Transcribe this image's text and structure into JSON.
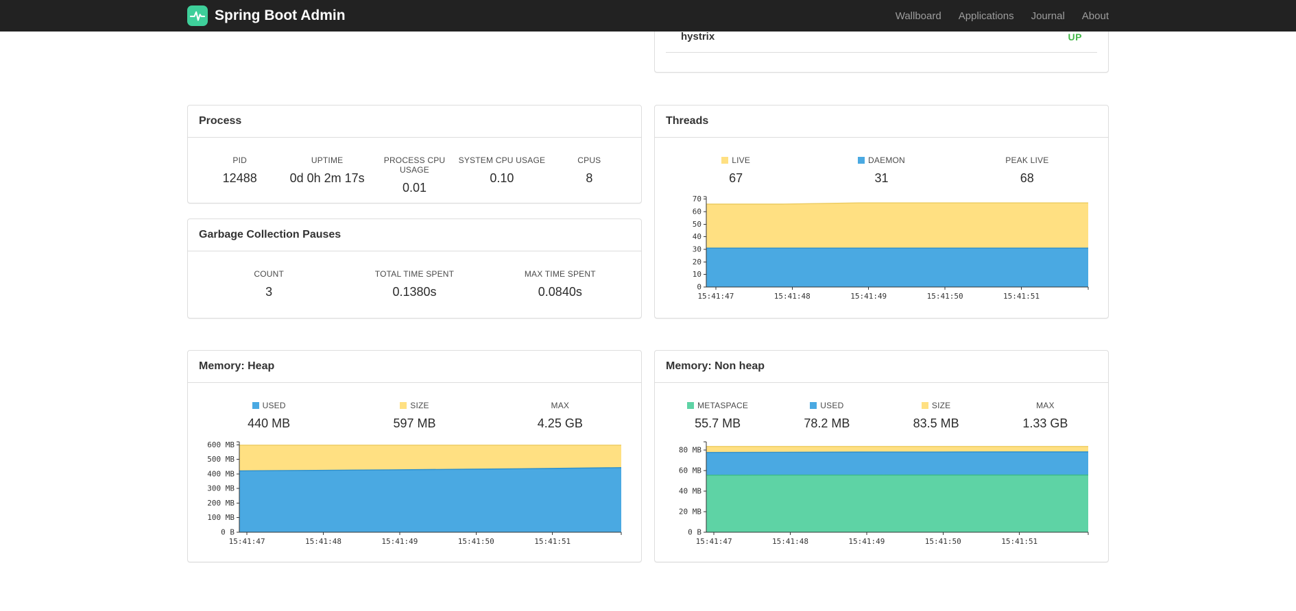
{
  "navbar": {
    "brand": "Spring Boot Admin",
    "links": [
      {
        "label": "Wallboard"
      },
      {
        "label": "Applications"
      },
      {
        "label": "Journal"
      },
      {
        "label": "About"
      }
    ]
  },
  "status_panel": {
    "app_name": "hystrix",
    "status": "UP",
    "status_color": "#44b749"
  },
  "process": {
    "title": "Process",
    "stats": [
      {
        "label": "PID",
        "value": "12488"
      },
      {
        "label": "UPTIME",
        "value": "0d 0h 2m 17s"
      },
      {
        "label": "PROCESS CPU USAGE",
        "value": "0.01"
      },
      {
        "label": "SYSTEM CPU USAGE",
        "value": "0.10"
      },
      {
        "label": "CPUS",
        "value": "8"
      }
    ]
  },
  "gc": {
    "title": "Garbage Collection Pauses",
    "stats": [
      {
        "label": "COUNT",
        "value": "3"
      },
      {
        "label": "TOTAL TIME SPENT",
        "value": "0.1380s"
      },
      {
        "label": "MAX TIME SPENT",
        "value": "0.0840s"
      }
    ]
  },
  "threads": {
    "title": "Threads",
    "stats": [
      {
        "label": "LIVE",
        "value": "67",
        "color": "#ffe082"
      },
      {
        "label": "DAEMON",
        "value": "31",
        "color": "#4aa9e2"
      },
      {
        "label": "PEAK LIVE",
        "value": "68"
      }
    ]
  },
  "heap": {
    "title": "Memory: Heap",
    "stats": [
      {
        "label": "USED",
        "value": "440 MB",
        "color": "#4aa9e2"
      },
      {
        "label": "SIZE",
        "value": "597 MB",
        "color": "#ffe082"
      },
      {
        "label": "MAX",
        "value": "4.25 GB"
      }
    ]
  },
  "nonheap": {
    "title": "Memory: Non heap",
    "stats": [
      {
        "label": "METASPACE",
        "value": "55.7 MB",
        "color": "#5ed3a5"
      },
      {
        "label": "USED",
        "value": "78.2 MB",
        "color": "#4aa9e2"
      },
      {
        "label": "SIZE",
        "value": "83.5 MB",
        "color": "#ffe082"
      },
      {
        "label": "MAX",
        "value": "1.33 GB"
      }
    ]
  },
  "chart_data": [
    {
      "id": "threads",
      "type": "area",
      "title": "Threads",
      "ylim": [
        0,
        72
      ],
      "grid": false,
      "legend_position": "top",
      "yticks": [
        {
          "v": 0,
          "label": "0"
        },
        {
          "v": 10,
          "label": "10"
        },
        {
          "v": 20,
          "label": "20"
        },
        {
          "v": 30,
          "label": "30"
        },
        {
          "v": 40,
          "label": "40"
        },
        {
          "v": 50,
          "label": "50"
        },
        {
          "v": 60,
          "label": "60"
        },
        {
          "v": 70,
          "label": "70"
        }
      ],
      "xticks": [
        {
          "pos": 0.025,
          "label": "15:41:47"
        },
        {
          "pos": 0.225,
          "label": "15:41:48"
        },
        {
          "pos": 0.425,
          "label": "15:41:49"
        },
        {
          "pos": 0.625,
          "label": "15:41:50"
        },
        {
          "pos": 0.825,
          "label": "15:41:51"
        }
      ],
      "series": [
        {
          "name": "LIVE",
          "color": "#ffe082",
          "line": "#eccb5f",
          "values": [
            66,
            66,
            67,
            67,
            67,
            67
          ]
        },
        {
          "name": "DAEMON",
          "color": "#4aa9e2",
          "line": "#2d8fcc",
          "values": [
            31,
            31,
            31,
            31,
            31,
            31
          ]
        }
      ]
    },
    {
      "id": "heap",
      "type": "area",
      "title": "Memory: Heap",
      "ylim": [
        0,
        620
      ],
      "grid": false,
      "legend_position": "top",
      "yticks": [
        {
          "v": 0,
          "label": "0 B"
        },
        {
          "v": 100,
          "label": "100 MB"
        },
        {
          "v": 200,
          "label": "200 MB"
        },
        {
          "v": 300,
          "label": "300 MB"
        },
        {
          "v": 400,
          "label": "400 MB"
        },
        {
          "v": 500,
          "label": "500 MB"
        },
        {
          "v": 600,
          "label": "600 MB"
        }
      ],
      "xticks": [
        {
          "pos": 0.02,
          "label": "15:41:47"
        },
        {
          "pos": 0.22,
          "label": "15:41:48"
        },
        {
          "pos": 0.42,
          "label": "15:41:49"
        },
        {
          "pos": 0.62,
          "label": "15:41:50"
        },
        {
          "pos": 0.82,
          "label": "15:41:51"
        }
      ],
      "series": [
        {
          "name": "SIZE",
          "color": "#ffe082",
          "line": "#eccb5f",
          "values": [
            597,
            597,
            597,
            597,
            597,
            597
          ]
        },
        {
          "name": "USED",
          "color": "#4aa9e2",
          "line": "#2d8fcc",
          "values": [
            421,
            424,
            428,
            432,
            437,
            443
          ]
        }
      ]
    },
    {
      "id": "nonheap",
      "type": "area",
      "title": "Memory: Non heap",
      "ylim": [
        0,
        88
      ],
      "grid": false,
      "legend_position": "top",
      "yticks": [
        {
          "v": 0,
          "label": "0 B"
        },
        {
          "v": 20,
          "label": "20 MB"
        },
        {
          "v": 40,
          "label": "40 MB"
        },
        {
          "v": 60,
          "label": "60 MB"
        },
        {
          "v": 80,
          "label": "80 MB"
        }
      ],
      "xticks": [
        {
          "pos": 0.02,
          "label": "15:41:47"
        },
        {
          "pos": 0.22,
          "label": "15:41:48"
        },
        {
          "pos": 0.42,
          "label": "15:41:49"
        },
        {
          "pos": 0.62,
          "label": "15:41:50"
        },
        {
          "pos": 0.82,
          "label": "15:41:51"
        }
      ],
      "series": [
        {
          "name": "SIZE",
          "color": "#ffe082",
          "line": "#eccb5f",
          "values": [
            83.5,
            83.5,
            83.5,
            83.5,
            83.5,
            83.5
          ]
        },
        {
          "name": "USED",
          "color": "#4aa9e2",
          "line": "#2d8fcc",
          "values": [
            77.6,
            77.8,
            78.0,
            78.1,
            78.2,
            78.2
          ]
        },
        {
          "name": "METASPACE",
          "color": "#5ed3a5",
          "line": "#3cb98a",
          "values": [
            55.5,
            55.6,
            55.6,
            55.7,
            55.7,
            55.7
          ]
        }
      ]
    }
  ]
}
